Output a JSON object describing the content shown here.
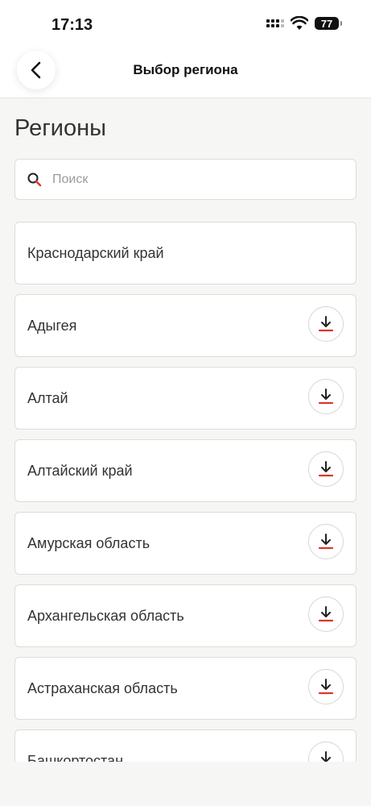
{
  "status_bar": {
    "time": "17:13",
    "battery": "77"
  },
  "header": {
    "title": "Выбор региона"
  },
  "section_title": "Регионы",
  "search": {
    "placeholder": "Поиск",
    "value": ""
  },
  "colors": {
    "accent": "#e0342a",
    "icon_dark": "#222222"
  },
  "regions": [
    {
      "label": "Краснодарский край",
      "downloadable": false
    },
    {
      "label": "Адыгея",
      "downloadable": true
    },
    {
      "label": "Алтай",
      "downloadable": true
    },
    {
      "label": "Алтайский край",
      "downloadable": true
    },
    {
      "label": "Амурская область",
      "downloadable": true
    },
    {
      "label": "Архангельская область",
      "downloadable": true
    },
    {
      "label": "Астраханская область",
      "downloadable": true
    },
    {
      "label": "Башкортостан",
      "downloadable": true
    }
  ]
}
